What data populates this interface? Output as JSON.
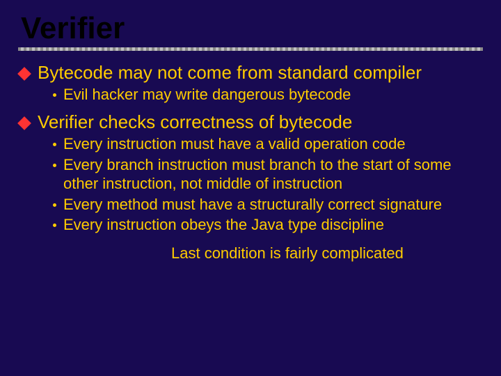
{
  "title": "Verifier",
  "points": [
    {
      "text": "Bytecode may not come from standard compiler",
      "subs": [
        "Evil hacker may write dangerous bytecode"
      ]
    },
    {
      "text": "Verifier checks correctness of bytecode",
      "subs": [
        "Every instruction must have a valid operation code",
        "Every branch instruction must branch to the start of some other instruction, not middle of instruction",
        "Every method must have a structurally correct signature",
        "Every instruction obeys the Java type discipline"
      ]
    }
  ],
  "footnote": "Last condition is fairly complicated"
}
